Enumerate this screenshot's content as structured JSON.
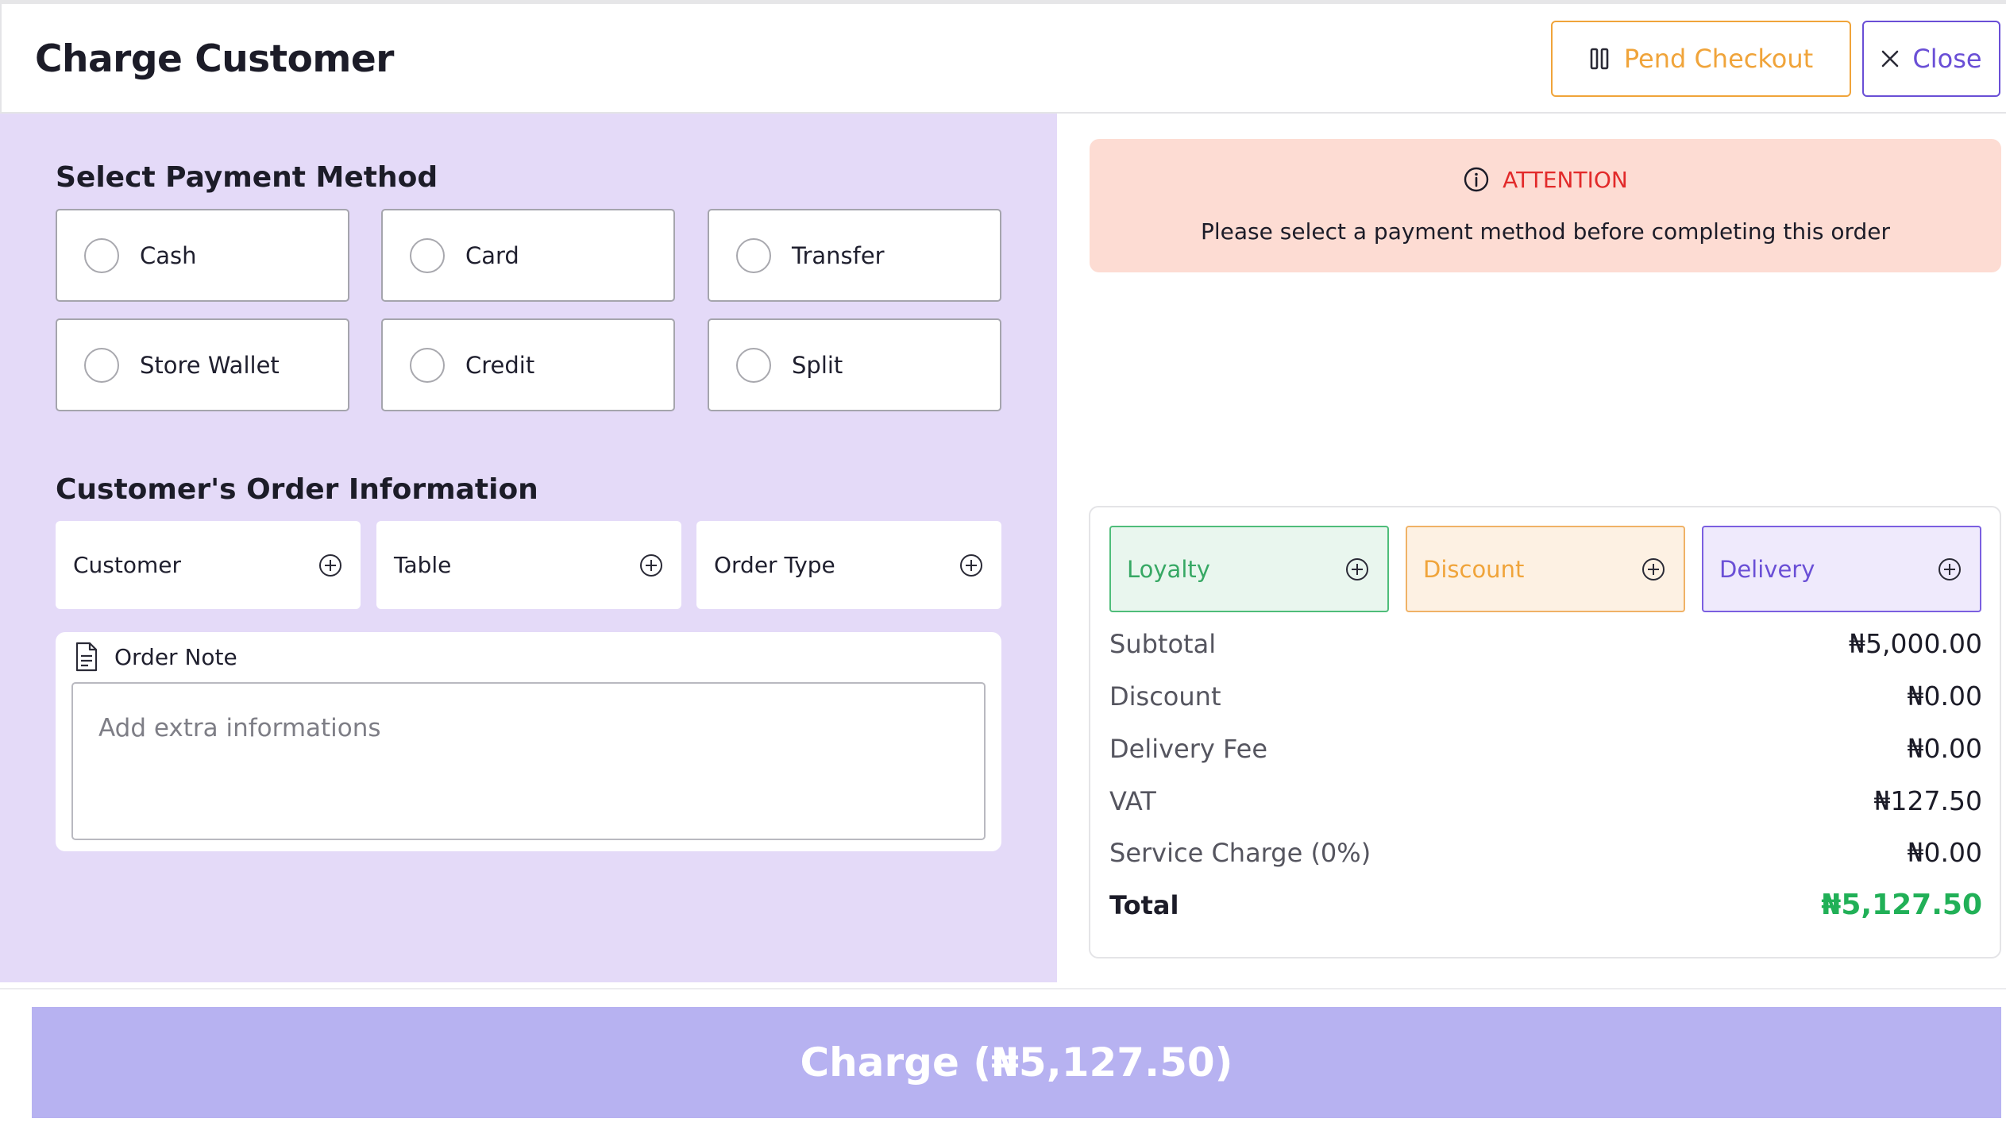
{
  "header": {
    "title": "Charge Customer",
    "pend_label": "Pend Checkout",
    "close_label": "Close",
    "pend_icon": "pause-icon",
    "close_icon": "close-icon"
  },
  "payment": {
    "section_title": "Select Payment Method",
    "methods": [
      {
        "label": "Cash",
        "selected": false
      },
      {
        "label": "Card",
        "selected": false
      },
      {
        "label": "Transfer",
        "selected": false
      },
      {
        "label": "Store Wallet",
        "selected": false
      },
      {
        "label": "Credit",
        "selected": false
      },
      {
        "label": "Split",
        "selected": false
      }
    ]
  },
  "order_info": {
    "section_title": "Customer's Order Information",
    "fields": [
      {
        "label": "Customer",
        "icon": "plus-circle-icon"
      },
      {
        "label": "Table",
        "icon": "plus-circle-icon"
      },
      {
        "label": "Order Type",
        "icon": "plus-circle-icon"
      }
    ],
    "note": {
      "label": "Order Note",
      "placeholder": "Add extra informations",
      "value": ""
    }
  },
  "alert": {
    "title": "ATTENTION",
    "message": "Please select a payment method before completing this order",
    "icon": "info-icon"
  },
  "summary": {
    "chips": [
      {
        "label": "Loyalty",
        "color": "#37a864"
      },
      {
        "label": "Discount",
        "color": "#f0a43a"
      },
      {
        "label": "Delivery",
        "color": "#6a4fd6"
      }
    ],
    "rows": [
      {
        "label": "Subtotal",
        "value": "₦5,000.00"
      },
      {
        "label": "Discount",
        "value": "₦0.00"
      },
      {
        "label": "Delivery Fee",
        "value": "₦0.00"
      },
      {
        "label": "VAT",
        "value": "₦127.50"
      },
      {
        "label": "Service Charge (0%)",
        "value": "₦0.00"
      }
    ],
    "total": {
      "label": "Total",
      "value": "₦5,127.50"
    }
  },
  "charge": {
    "label": "Charge (₦5,127.50)"
  },
  "colors": {
    "accent": "#6a4fd6",
    "pend": "#f0a43a",
    "panel_bg": "#e4daf8",
    "alert_bg": "#fddcd3",
    "alert_text": "#e22a2a",
    "total_green": "#21b057",
    "charge_bg": "#b7b2f1"
  }
}
